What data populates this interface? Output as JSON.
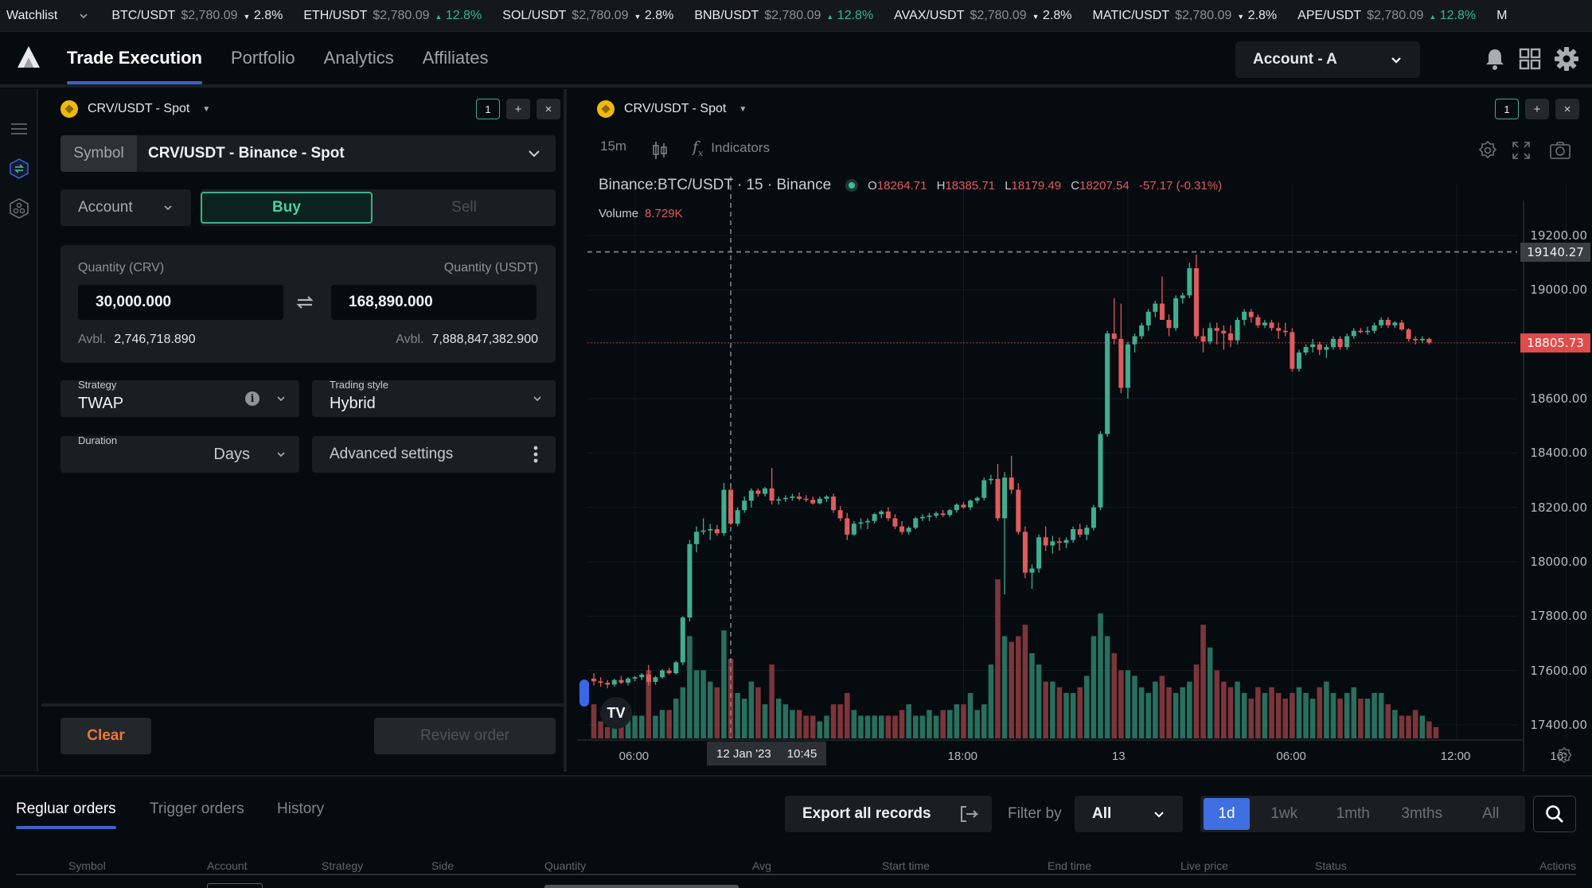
{
  "watchlist": {
    "label": "Watchlist",
    "items": [
      {
        "symbol": "BTC/USDT",
        "price": "$2,780.09",
        "change": "2.8%",
        "dir": "down"
      },
      {
        "symbol": "ETH/USDT",
        "price": "$2,780.09",
        "change": "12.8%",
        "dir": "up"
      },
      {
        "symbol": "SOL/USDT",
        "price": "$2,780.09",
        "change": "2.8%",
        "dir": "down"
      },
      {
        "symbol": "BNB/USDT",
        "price": "$2,780.09",
        "change": "12.8%",
        "dir": "up"
      },
      {
        "symbol": "AVAX/USDT",
        "price": "$2,780.09",
        "change": "2.8%",
        "dir": "down"
      },
      {
        "symbol": "MATIC/USDT",
        "price": "$2,780.09",
        "change": "2.8%",
        "dir": "down"
      },
      {
        "symbol": "APE/USDT",
        "price": "$2,780.09",
        "change": "12.8%",
        "dir": "up"
      },
      {
        "symbol": "M",
        "price": "",
        "change": "",
        "dir": ""
      }
    ],
    "colors": {
      "up": "#2fb88f",
      "down": "#e0603f"
    }
  },
  "nav": {
    "tabs": [
      {
        "label": "Trade Execution",
        "active": true
      },
      {
        "label": "Portfolio",
        "active": false
      },
      {
        "label": "Analytics",
        "active": false
      },
      {
        "label": "Affiliates",
        "active": false
      }
    ],
    "account": "Account - A",
    "icons": [
      "bell-icon",
      "grid-icon",
      "gear-icon"
    ]
  },
  "rail": {
    "icons": [
      "menu-icon",
      "exchange-icon",
      "strategy-icon"
    ]
  },
  "order_panel": {
    "pair_title": "CRV/USDT - Spot",
    "pane_index": "1",
    "symbol_label": "Symbol",
    "symbol_value": "CRV/USDT - Binance - Spot",
    "account_label": "Account",
    "buy_label": "Buy",
    "sell_label": "Sell",
    "qty_base_label": "Quantity (CRV)",
    "qty_quote_label": "Quantity (USDT)",
    "qty_base_value": "30,000.000",
    "qty_quote_value": "168,890.000",
    "avbl_label": "Avbl.",
    "avbl_base": "2,746,718.890",
    "avbl_quote": "7,888,847,382.900",
    "strategy_label": "Strategy",
    "strategy_value": "TWAP",
    "trading_style_label": "Trading style",
    "trading_style_value": "Hybrid",
    "duration_label": "Duration",
    "duration_unit": "Days",
    "advanced_label": "Advanced settings",
    "clear_label": "Clear",
    "review_label": "Review order"
  },
  "chart_panel": {
    "pair_title": "CRV/USDT - Spot",
    "pane_index": "1",
    "interval": "15m",
    "indicators_label": "Indicators",
    "legend_symbol": "Binance:BTC/USDT · 15 · Binance",
    "ohlc": {
      "O": "18264.71",
      "H": "18385.71",
      "L": "18179.49",
      "C": "18207.54",
      "change": "-57.17 (-0.31%)"
    },
    "volume_label": "Volume",
    "volume_value": "8.729K",
    "crosshair_price": "19140.27",
    "last_price": "18805.73",
    "crosshair_time": [
      "12 Jan '23",
      "10:45"
    ],
    "colors": {
      "up": "#3fae8f",
      "down": "#e05b5b",
      "last_price_bg": "#e04b4b"
    }
  },
  "chart_data": {
    "type": "candlestick",
    "title": "Binance:BTC/USDT · 15 · Binance",
    "interval": "15m",
    "ylim": [
      17350,
      19300
    ],
    "y_ticks": [
      "19200.00",
      "19000.00",
      "18600.00",
      "18400.00",
      "18200.00",
      "18000.00",
      "17800.00",
      "17600.00",
      "17400.00"
    ],
    "y_tick_values": [
      19200,
      19000,
      18600,
      18400,
      18200,
      18000,
      17800,
      17600,
      17400
    ],
    "x_ticks": [
      "06:00",
      "18:00",
      "13",
      "06:00",
      "12:00",
      "16:"
    ],
    "x_tick_index": [
      6,
      54,
      78,
      102,
      126,
      142
    ],
    "candles": [
      [
        17570,
        17590,
        17545,
        17560
      ],
      [
        17560,
        17575,
        17540,
        17555
      ],
      [
        17555,
        17565,
        17535,
        17548
      ],
      [
        17548,
        17570,
        17540,
        17565
      ],
      [
        17565,
        17580,
        17550,
        17555
      ],
      [
        17555,
        17575,
        17545,
        17570
      ],
      [
        17570,
        17580,
        17560,
        17575
      ],
      [
        17575,
        17590,
        17565,
        17585
      ],
      [
        17585,
        17620,
        17545,
        17558
      ],
      [
        17558,
        17580,
        17548,
        17575
      ],
      [
        17575,
        17605,
        17570,
        17600
      ],
      [
        17600,
        17610,
        17585,
        17590
      ],
      [
        17590,
        17635,
        17585,
        17630
      ],
      [
        17630,
        17800,
        17620,
        17795
      ],
      [
        17795,
        18080,
        17780,
        18065
      ],
      [
        18065,
        18130,
        18035,
        18110
      ],
      [
        18110,
        18160,
        18100,
        18115
      ],
      [
        18115,
        18140,
        18080,
        18120
      ],
      [
        18120,
        18135,
        18095,
        18105
      ],
      [
        18105,
        18290,
        18095,
        18265
      ],
      [
        18265,
        18280,
        18135,
        18140
      ],
      [
        18140,
        18200,
        18130,
        18190
      ],
      [
        18190,
        18240,
        18180,
        18225
      ],
      [
        18225,
        18270,
        18200,
        18262
      ],
      [
        18262,
        18270,
        18240,
        18250
      ],
      [
        18250,
        18275,
        18240,
        18270
      ],
      [
        18270,
        18345,
        18210,
        18225
      ],
      [
        18225,
        18240,
        18210,
        18230
      ],
      [
        18230,
        18245,
        18220,
        18235
      ],
      [
        18235,
        18250,
        18225,
        18240
      ],
      [
        18240,
        18255,
        18225,
        18232
      ],
      [
        18232,
        18245,
        18220,
        18228
      ],
      [
        18228,
        18240,
        18210,
        18215
      ],
      [
        18215,
        18240,
        18210,
        18232
      ],
      [
        18232,
        18245,
        18220,
        18240
      ],
      [
        18240,
        18250,
        18180,
        18190
      ],
      [
        18190,
        18205,
        18150,
        18160
      ],
      [
        18160,
        18180,
        18080,
        18100
      ],
      [
        18100,
        18150,
        18095,
        18140
      ],
      [
        18140,
        18160,
        18120,
        18145
      ],
      [
        18145,
        18160,
        18120,
        18150
      ],
      [
        18150,
        18180,
        18140,
        18175
      ],
      [
        18175,
        18190,
        18160,
        18185
      ],
      [
        18185,
        18200,
        18150,
        18160
      ],
      [
        18160,
        18175,
        18120,
        18130
      ],
      [
        18130,
        18150,
        18100,
        18110
      ],
      [
        18110,
        18130,
        18100,
        18125
      ],
      [
        18125,
        18165,
        18120,
        18160
      ],
      [
        18160,
        18175,
        18150,
        18165
      ],
      [
        18165,
        18180,
        18150,
        18170
      ],
      [
        18170,
        18185,
        18160,
        18178
      ],
      [
        18178,
        18190,
        18165,
        18172
      ],
      [
        18172,
        18195,
        18165,
        18190
      ],
      [
        18190,
        18215,
        18180,
        18210
      ],
      [
        18210,
        18220,
        18195,
        18200
      ],
      [
        18200,
        18230,
        18190,
        18225
      ],
      [
        18225,
        18240,
        18215,
        18235
      ],
      [
        18235,
        18310,
        18225,
        18300
      ],
      [
        18300,
        18320,
        18285,
        18305
      ],
      [
        18305,
        18360,
        18150,
        18160
      ],
      [
        18160,
        18330,
        17880,
        18310
      ],
      [
        18310,
        18390,
        18250,
        18265
      ],
      [
        18265,
        18290,
        18100,
        18110
      ],
      [
        18110,
        18130,
        17940,
        17960
      ],
      [
        17960,
        17990,
        17900,
        17975
      ],
      [
        17975,
        18100,
        17960,
        18090
      ],
      [
        18090,
        18130,
        18040,
        18060
      ],
      [
        18060,
        18095,
        18030,
        18075
      ],
      [
        18075,
        18090,
        18040,
        18070
      ],
      [
        18070,
        18090,
        18050,
        18080
      ],
      [
        18080,
        18130,
        18070,
        18120
      ],
      [
        18120,
        18140,
        18090,
        18100
      ],
      [
        18100,
        18135,
        18080,
        18125
      ],
      [
        18125,
        18210,
        18115,
        18200
      ],
      [
        18200,
        18480,
        18190,
        18470
      ],
      [
        18470,
        18850,
        18460,
        18840
      ],
      [
        18840,
        18970,
        18800,
        18820
      ],
      [
        18820,
        18950,
        18620,
        18640
      ],
      [
        18640,
        18810,
        18600,
        18800
      ],
      [
        18800,
        18840,
        18770,
        18830
      ],
      [
        18830,
        18880,
        18820,
        18870
      ],
      [
        18870,
        18930,
        18850,
        18920
      ],
      [
        18920,
        18960,
        18900,
        18950
      ],
      [
        18950,
        19050,
        18920,
        18890
      ],
      [
        18890,
        18910,
        18830,
        18860
      ],
      [
        18860,
        18980,
        18850,
        18970
      ],
      [
        18970,
        18990,
        18950,
        18980
      ],
      [
        18980,
        19100,
        18970,
        19080
      ],
      [
        19080,
        19130,
        18820,
        18830
      ],
      [
        18830,
        18860,
        18770,
        18810
      ],
      [
        18810,
        18880,
        18800,
        18860
      ],
      [
        18860,
        18880,
        18800,
        18850
      ],
      [
        18850,
        18870,
        18780,
        18840
      ],
      [
        18840,
        18870,
        18790,
        18815
      ],
      [
        18815,
        18900,
        18800,
        18890
      ],
      [
        18890,
        18930,
        18870,
        18920
      ],
      [
        18920,
        18930,
        18880,
        18900
      ],
      [
        18900,
        18910,
        18860,
        18870
      ],
      [
        18870,
        18890,
        18860,
        18880
      ],
      [
        18880,
        18890,
        18850,
        18860
      ],
      [
        18860,
        18880,
        18820,
        18850
      ],
      [
        18850,
        18880,
        18830,
        18845
      ],
      [
        18845,
        18860,
        18700,
        18710
      ],
      [
        18710,
        18780,
        18700,
        18770
      ],
      [
        18770,
        18800,
        18760,
        18790
      ],
      [
        18790,
        18820,
        18770,
        18800
      ],
      [
        18800,
        18810,
        18760,
        18780
      ],
      [
        18780,
        18800,
        18750,
        18790
      ],
      [
        18790,
        18830,
        18780,
        18820
      ],
      [
        18820,
        18830,
        18780,
        18790
      ],
      [
        18790,
        18840,
        18780,
        18830
      ],
      [
        18830,
        18860,
        18820,
        18850
      ],
      [
        18850,
        18860,
        18840,
        18845
      ],
      [
        18845,
        18865,
        18835,
        18850
      ],
      [
        18850,
        18880,
        18840,
        18870
      ],
      [
        18870,
        18900,
        18860,
        18890
      ],
      [
        18890,
        18900,
        18860,
        18870
      ],
      [
        18870,
        18885,
        18860,
        18880
      ],
      [
        18880,
        18890,
        18850,
        18855
      ],
      [
        18855,
        18860,
        18810,
        18820
      ],
      [
        18820,
        18830,
        18800,
        18815
      ],
      [
        18815,
        18830,
        18805,
        18820
      ],
      [
        18820,
        18825,
        18800,
        18806
      ]
    ],
    "volumes": [
      6,
      3,
      2,
      4,
      3,
      4,
      4,
      4,
      12,
      4,
      5,
      5,
      7,
      9,
      18,
      12,
      12,
      10,
      9,
      19,
      14,
      8,
      7,
      10,
      9,
      6,
      13,
      7,
      6,
      5,
      5,
      4,
      4,
      3,
      4,
      6,
      6,
      8,
      5,
      4,
      4,
      4,
      4,
      4,
      4,
      5,
      6,
      4,
      4,
      5,
      4,
      5,
      5,
      6,
      6,
      8,
      5,
      6,
      13,
      28,
      18,
      17,
      18,
      20,
      15,
      13,
      10,
      10,
      9,
      8,
      8,
      9,
      11,
      18,
      22,
      18,
      15,
      12,
      12,
      11,
      9,
      8,
      10,
      11,
      9,
      8,
      9,
      10,
      13,
      20,
      16,
      12,
      10,
      9,
      10,
      8,
      7,
      9,
      8,
      9,
      8,
      7,
      8,
      9,
      8,
      7,
      9,
      10,
      8,
      7,
      8,
      9,
      7,
      7,
      8,
      8,
      6,
      5,
      4,
      4,
      5,
      4,
      3,
      2
    ]
  },
  "orders": {
    "tabs": [
      {
        "label": "Regluar orders",
        "active": true
      },
      {
        "label": "Trigger orders",
        "active": false
      },
      {
        "label": "History",
        "active": false
      }
    ],
    "export_label": "Export all records",
    "filter_label": "Filter by",
    "filter_value": "All",
    "ranges": [
      {
        "label": "1d",
        "active": true
      },
      {
        "label": "1wk",
        "active": false
      },
      {
        "label": "1mth",
        "active": false
      },
      {
        "label": "3mths",
        "active": false
      },
      {
        "label": "All",
        "active": false
      }
    ],
    "columns": [
      "Symbol",
      "Account",
      "Strategy",
      "Side",
      "Quantity",
      "Avg",
      "Start time",
      "End time",
      "Live price",
      "Status",
      "Actions"
    ]
  }
}
